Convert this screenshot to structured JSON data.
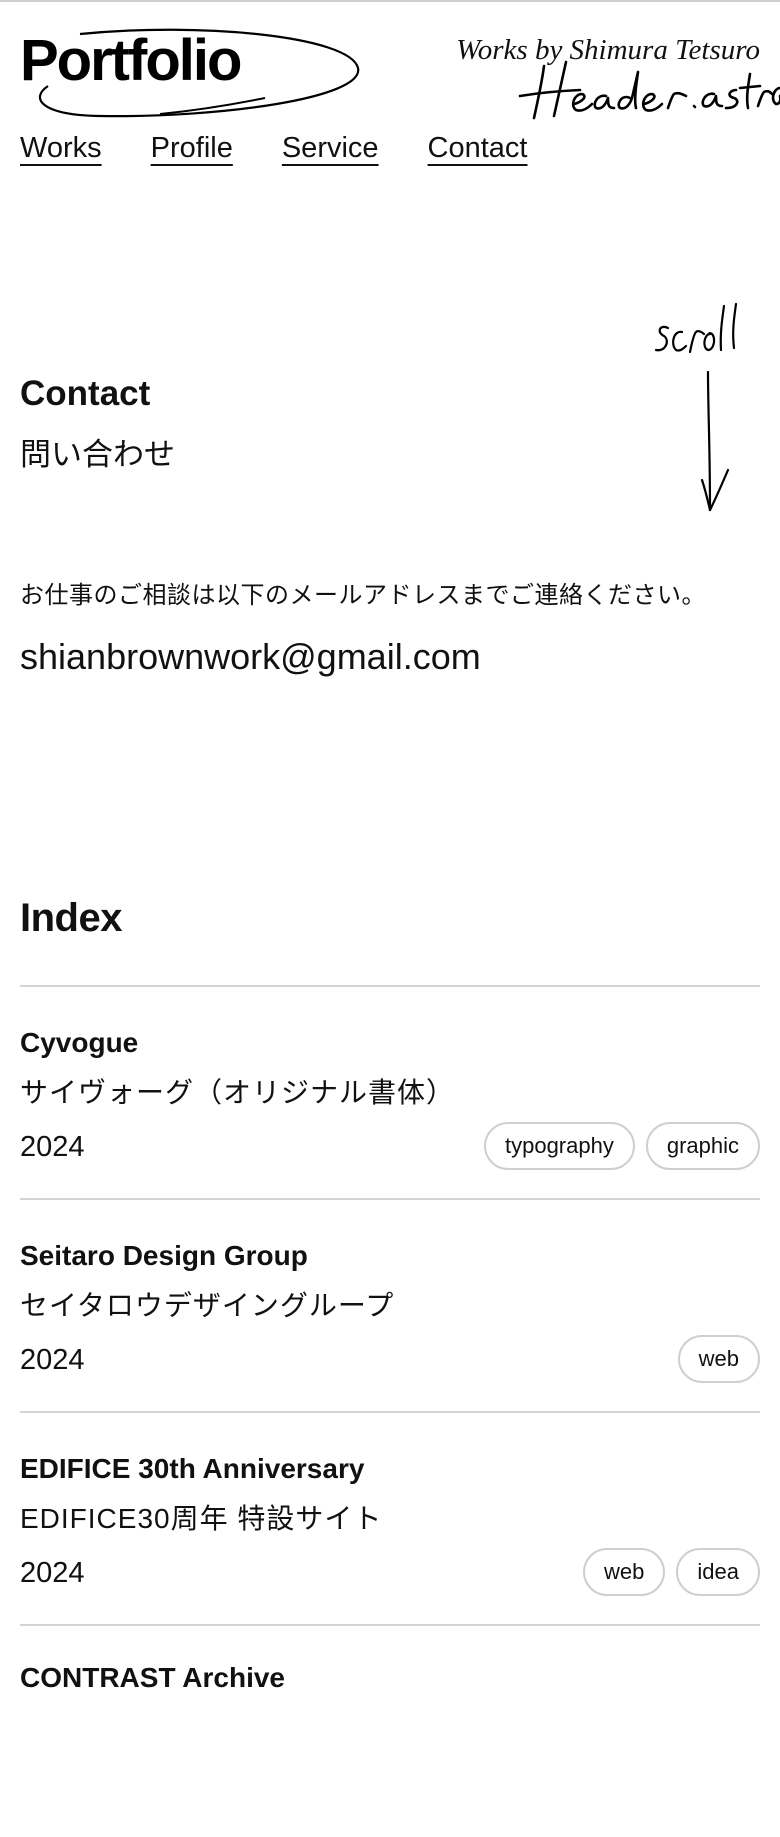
{
  "header": {
    "logo": "Portfolio",
    "byline": "Works by Shimura Tetsuro",
    "handwritten_label": "Header.astro"
  },
  "nav": [
    "Works",
    "Profile",
    "Service",
    "Contact"
  ],
  "contact": {
    "title": "Contact",
    "subtitle": "問い合わせ",
    "scroll_hint": "scroll",
    "message": "お仕事のご相談は以下のメールアドレスまでご連絡ください。",
    "email": "shianbrownwork@gmail.com"
  },
  "index": {
    "title": "Index",
    "items": [
      {
        "name": "Cyvogue",
        "jp": "サイヴォーグ（オリジナル書体）",
        "year": "2024",
        "tags": [
          "typography",
          "graphic"
        ]
      },
      {
        "name": "Seitaro Design Group",
        "jp": "セイタロウデザイングループ",
        "year": "2024",
        "tags": [
          "web"
        ]
      },
      {
        "name": "EDIFICE 30th Anniversary",
        "jp": "EDIFICE30周年 特設サイト",
        "year": "2024",
        "tags": [
          "web",
          "idea"
        ]
      },
      {
        "name": "CONTRAST Archive",
        "jp": "",
        "year": "",
        "tags": []
      }
    ]
  }
}
